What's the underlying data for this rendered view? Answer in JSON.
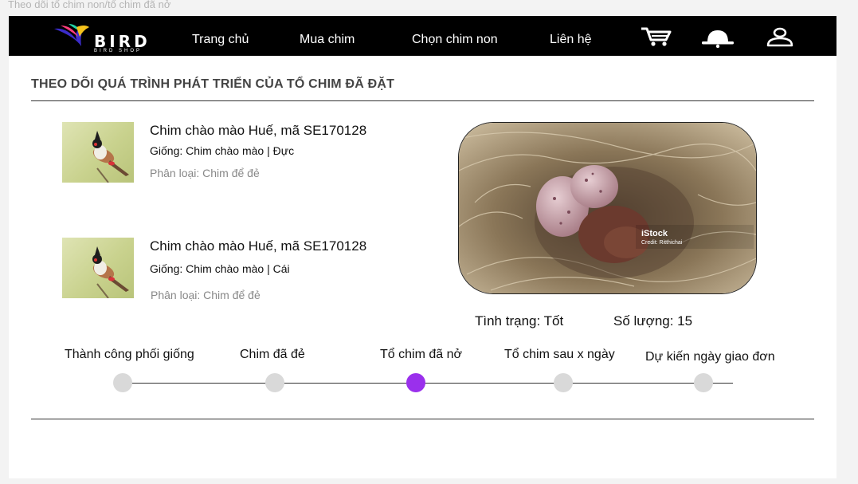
{
  "frame_label": "Theo dõi tổ chim non/tổ chim đã nở",
  "logo": {
    "text": "BIRD",
    "sub": "BIRD SHOP"
  },
  "nav": {
    "items": [
      "Trang chủ",
      "Mua chim",
      "Chọn chim non",
      "Liên hệ"
    ],
    "icons": [
      "cart-icon",
      "bell-icon",
      "user-icon"
    ]
  },
  "page": {
    "title": "THEO DÕI QUÁ TRÌNH PHÁT TRIỂN CỦA TỔ CHIM ĐÃ ĐẶT"
  },
  "birds": [
    {
      "name": "Chim chào mào Huế, mã SE170128",
      "breed": "Giống: Chim chào mào | Đực",
      "type": "Phân loại: Chim để đẻ"
    },
    {
      "name": "Chim chào mào Huế, mã SE170128",
      "breed": "Giống: Chim chào mào | Cái",
      "type": "Phân loại: Chim để đẻ"
    }
  ],
  "photo": {
    "watermark": "iStock",
    "credit": "Credit: Ritthichai"
  },
  "status": {
    "condition": "Tình trạng: Tốt",
    "quantity": "Số lượng: 15"
  },
  "steps": [
    {
      "label": "Thành công phối giống",
      "active": false
    },
    {
      "label": "Chim đã đẻ",
      "active": false
    },
    {
      "label": "Tổ chim đã nở",
      "active": true
    },
    {
      "label": "Tổ chim sau x ngày",
      "active": false
    },
    {
      "label": "Dự kiến ngày giao đơn",
      "active": false
    }
  ],
  "colors": {
    "navbar": "#000000",
    "active_step": "#9a30ec",
    "inactive_step": "#d9d9d9"
  }
}
